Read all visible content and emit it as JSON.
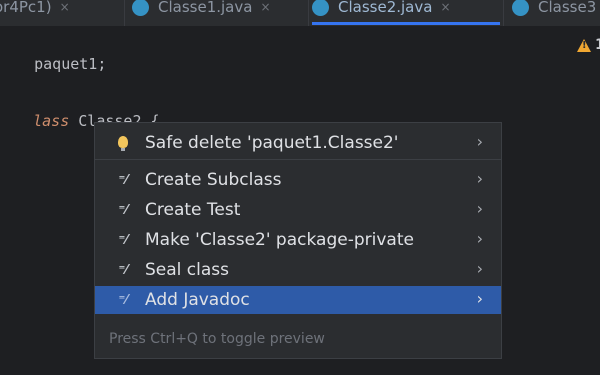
{
  "tabs": [
    {
      "label": "or4Pc1)",
      "has_icon": false,
      "active": false
    },
    {
      "label": "Classe1.java",
      "has_icon": true,
      "active": false
    },
    {
      "label": "Classe2.java",
      "has_icon": true,
      "active": true
    },
    {
      "label": "Classe3",
      "has_icon": true,
      "active": false
    }
  ],
  "tab_close_glyph": "×",
  "code": {
    "line1": "paquet1;",
    "line3_keyword": "lass",
    "line3_rest": " Classe2 {"
  },
  "warnings": {
    "count": "1"
  },
  "popup": {
    "items": [
      {
        "label": "Safe delete 'paquet1.Classe2'",
        "icon": "lightbulb-icon",
        "selected": false
      },
      {
        "label": "Create Subclass",
        "icon": "wand-icon",
        "selected": false
      },
      {
        "label": "Create Test",
        "icon": "wand-icon",
        "selected": false
      },
      {
        "label": "Make 'Classe2' package-private",
        "icon": "wand-icon",
        "selected": false
      },
      {
        "label": "Seal class",
        "icon": "wand-icon",
        "selected": false
      },
      {
        "label": "Add Javadoc",
        "icon": "wand-icon",
        "selected": true
      }
    ],
    "chevron": "›",
    "hint": "Press Ctrl+Q to toggle preview"
  },
  "colors": {
    "editor_bg": "#1e1f22",
    "popup_bg": "#2b2d30",
    "selection": "#2e5ba8",
    "keyword": "#cf8e6d",
    "tab_accent": "#3574f0"
  }
}
